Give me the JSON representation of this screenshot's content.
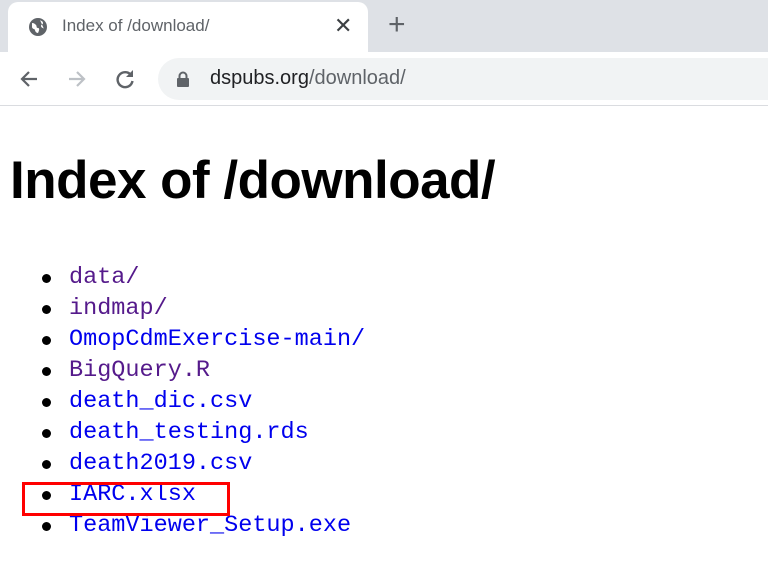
{
  "browser": {
    "tab_title": "Index of /download/",
    "url_domain": "dspubs.org",
    "url_path": "/download/"
  },
  "page": {
    "heading": "Index of /download/",
    "items": [
      {
        "label": "data/",
        "visited": true
      },
      {
        "label": "indmap/",
        "visited": true
      },
      {
        "label": "OmopCdmExercise-main/",
        "visited": false
      },
      {
        "label": "BigQuery.R",
        "visited": true
      },
      {
        "label": "death_dic.csv",
        "visited": false
      },
      {
        "label": "death_testing.rds",
        "visited": false
      },
      {
        "label": "death2019.csv",
        "visited": false
      },
      {
        "label": "IARC.xlsx",
        "visited": false,
        "highlighted": true
      },
      {
        "label": "TeamViewer_Setup.exe",
        "visited": false
      }
    ]
  },
  "colors": {
    "link": "#0000ee",
    "visited": "#551a8b",
    "highlight": "#ff0000"
  }
}
